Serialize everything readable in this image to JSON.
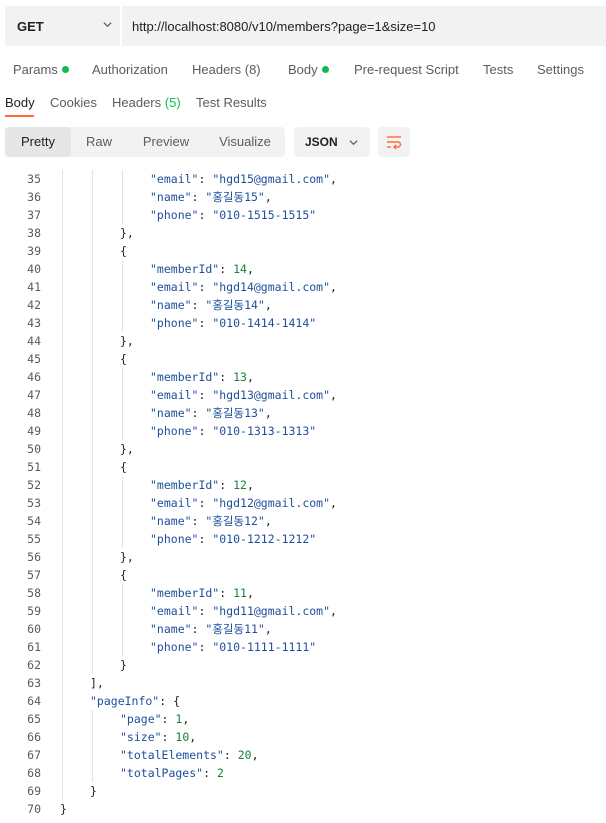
{
  "request": {
    "method": "GET",
    "url": "http://localhost:8080/v10/members?page=1&size=10"
  },
  "request_tabs": [
    {
      "label": "Params",
      "dot": true
    },
    {
      "label": "Authorization",
      "dot": false
    },
    {
      "label": "Headers (8)",
      "dot": false
    },
    {
      "label": "Body",
      "dot": true
    },
    {
      "label": "Pre-request Script",
      "dot": false
    },
    {
      "label": "Tests",
      "dot": false
    },
    {
      "label": "Settings",
      "dot": false
    }
  ],
  "response_tabs": {
    "body": "Body",
    "cookies": "Cookies",
    "headers": "Headers",
    "headers_count": "(5)",
    "test_results": "Test Results"
  },
  "view_modes": {
    "pretty": "Pretty",
    "raw": "Raw",
    "preview": "Preview",
    "visualize": "Visualize"
  },
  "format": "JSON",
  "colors": {
    "accent": "#ff6c37",
    "status_dot": "#0cbb52",
    "json_key": "#1d4f9c",
    "json_number": "#17803d"
  },
  "code_lines": [
    {
      "n": "35",
      "indent": 3,
      "parts": [
        [
          "k",
          "\"email\""
        ],
        [
          "p",
          ": "
        ],
        [
          "s",
          "\"hgd15@gmail.com\""
        ],
        [
          "p",
          ","
        ]
      ]
    },
    {
      "n": "36",
      "indent": 3,
      "parts": [
        [
          "k",
          "\"name\""
        ],
        [
          "p",
          ": "
        ],
        [
          "s",
          "\"홍길동15\""
        ],
        [
          "p",
          ","
        ]
      ]
    },
    {
      "n": "37",
      "indent": 3,
      "parts": [
        [
          "k",
          "\"phone\""
        ],
        [
          "p",
          ": "
        ],
        [
          "s",
          "\"010-1515-1515\""
        ]
      ]
    },
    {
      "n": "38",
      "indent": 2,
      "parts": [
        [
          "p",
          "},"
        ]
      ]
    },
    {
      "n": "39",
      "indent": 2,
      "parts": [
        [
          "p",
          "{"
        ]
      ]
    },
    {
      "n": "40",
      "indent": 3,
      "parts": [
        [
          "k",
          "\"memberId\""
        ],
        [
          "p",
          ": "
        ],
        [
          "n",
          "14"
        ],
        [
          "p",
          ","
        ]
      ]
    },
    {
      "n": "41",
      "indent": 3,
      "parts": [
        [
          "k",
          "\"email\""
        ],
        [
          "p",
          ": "
        ],
        [
          "s",
          "\"hgd14@gmail.com\""
        ],
        [
          "p",
          ","
        ]
      ]
    },
    {
      "n": "42",
      "indent": 3,
      "parts": [
        [
          "k",
          "\"name\""
        ],
        [
          "p",
          ": "
        ],
        [
          "s",
          "\"홍길동14\""
        ],
        [
          "p",
          ","
        ]
      ]
    },
    {
      "n": "43",
      "indent": 3,
      "parts": [
        [
          "k",
          "\"phone\""
        ],
        [
          "p",
          ": "
        ],
        [
          "s",
          "\"010-1414-1414\""
        ]
      ]
    },
    {
      "n": "44",
      "indent": 2,
      "parts": [
        [
          "p",
          "},"
        ]
      ]
    },
    {
      "n": "45",
      "indent": 2,
      "parts": [
        [
          "p",
          "{"
        ]
      ]
    },
    {
      "n": "46",
      "indent": 3,
      "parts": [
        [
          "k",
          "\"memberId\""
        ],
        [
          "p",
          ": "
        ],
        [
          "n",
          "13"
        ],
        [
          "p",
          ","
        ]
      ]
    },
    {
      "n": "47",
      "indent": 3,
      "parts": [
        [
          "k",
          "\"email\""
        ],
        [
          "p",
          ": "
        ],
        [
          "s",
          "\"hgd13@gmail.com\""
        ],
        [
          "p",
          ","
        ]
      ]
    },
    {
      "n": "48",
      "indent": 3,
      "parts": [
        [
          "k",
          "\"name\""
        ],
        [
          "p",
          ": "
        ],
        [
          "s",
          "\"홍길동13\""
        ],
        [
          "p",
          ","
        ]
      ]
    },
    {
      "n": "49",
      "indent": 3,
      "parts": [
        [
          "k",
          "\"phone\""
        ],
        [
          "p",
          ": "
        ],
        [
          "s",
          "\"010-1313-1313\""
        ]
      ]
    },
    {
      "n": "50",
      "indent": 2,
      "parts": [
        [
          "p",
          "},"
        ]
      ]
    },
    {
      "n": "51",
      "indent": 2,
      "parts": [
        [
          "p",
          "{"
        ]
      ]
    },
    {
      "n": "52",
      "indent": 3,
      "parts": [
        [
          "k",
          "\"memberId\""
        ],
        [
          "p",
          ": "
        ],
        [
          "n",
          "12"
        ],
        [
          "p",
          ","
        ]
      ]
    },
    {
      "n": "53",
      "indent": 3,
      "parts": [
        [
          "k",
          "\"email\""
        ],
        [
          "p",
          ": "
        ],
        [
          "s",
          "\"hgd12@gmail.com\""
        ],
        [
          "p",
          ","
        ]
      ]
    },
    {
      "n": "54",
      "indent": 3,
      "parts": [
        [
          "k",
          "\"name\""
        ],
        [
          "p",
          ": "
        ],
        [
          "s",
          "\"홍길동12\""
        ],
        [
          "p",
          ","
        ]
      ]
    },
    {
      "n": "55",
      "indent": 3,
      "parts": [
        [
          "k",
          "\"phone\""
        ],
        [
          "p",
          ": "
        ],
        [
          "s",
          "\"010-1212-1212\""
        ]
      ]
    },
    {
      "n": "56",
      "indent": 2,
      "parts": [
        [
          "p",
          "},"
        ]
      ]
    },
    {
      "n": "57",
      "indent": 2,
      "parts": [
        [
          "p",
          "{"
        ]
      ]
    },
    {
      "n": "58",
      "indent": 3,
      "parts": [
        [
          "k",
          "\"memberId\""
        ],
        [
          "p",
          ": "
        ],
        [
          "n",
          "11"
        ],
        [
          "p",
          ","
        ]
      ]
    },
    {
      "n": "59",
      "indent": 3,
      "parts": [
        [
          "k",
          "\"email\""
        ],
        [
          "p",
          ": "
        ],
        [
          "s",
          "\"hgd11@gmail.com\""
        ],
        [
          "p",
          ","
        ]
      ]
    },
    {
      "n": "60",
      "indent": 3,
      "parts": [
        [
          "k",
          "\"name\""
        ],
        [
          "p",
          ": "
        ],
        [
          "s",
          "\"홍길동11\""
        ],
        [
          "p",
          ","
        ]
      ]
    },
    {
      "n": "61",
      "indent": 3,
      "parts": [
        [
          "k",
          "\"phone\""
        ],
        [
          "p",
          ": "
        ],
        [
          "s",
          "\"010-1111-1111\""
        ]
      ]
    },
    {
      "n": "62",
      "indent": 2,
      "parts": [
        [
          "p",
          "}"
        ]
      ]
    },
    {
      "n": "63",
      "indent": 1,
      "parts": [
        [
          "p",
          "],"
        ]
      ]
    },
    {
      "n": "64",
      "indent": 1,
      "parts": [
        [
          "k",
          "\"pageInfo\""
        ],
        [
          "p",
          ": {"
        ]
      ]
    },
    {
      "n": "65",
      "indent": 2,
      "parts": [
        [
          "k",
          "\"page\""
        ],
        [
          "p",
          ": "
        ],
        [
          "n",
          "1"
        ],
        [
          "p",
          ","
        ]
      ]
    },
    {
      "n": "66",
      "indent": 2,
      "parts": [
        [
          "k",
          "\"size\""
        ],
        [
          "p",
          ": "
        ],
        [
          "n",
          "10"
        ],
        [
          "p",
          ","
        ]
      ]
    },
    {
      "n": "67",
      "indent": 2,
      "parts": [
        [
          "k",
          "\"totalElements\""
        ],
        [
          "p",
          ": "
        ],
        [
          "n",
          "20"
        ],
        [
          "p",
          ","
        ]
      ]
    },
    {
      "n": "68",
      "indent": 2,
      "parts": [
        [
          "k",
          "\"totalPages\""
        ],
        [
          "p",
          ": "
        ],
        [
          "n",
          "2"
        ]
      ]
    },
    {
      "n": "69",
      "indent": 1,
      "parts": [
        [
          "p",
          "}"
        ]
      ]
    },
    {
      "n": "70",
      "indent": 0,
      "parts": [
        [
          "p",
          "}"
        ]
      ]
    }
  ]
}
